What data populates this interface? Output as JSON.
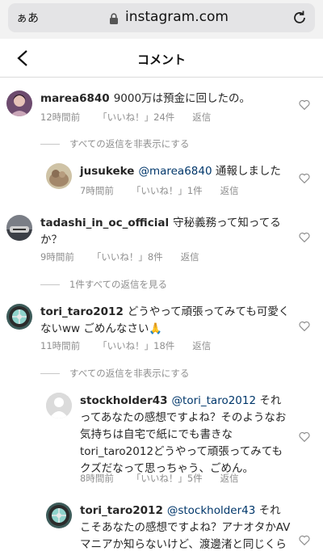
{
  "browser": {
    "text_size_label": "ぁあ",
    "domain": "instagram.com"
  },
  "header": {
    "title": "コメント"
  },
  "comments": [
    {
      "username": "marea6840",
      "text": "9000万は預金に回したの。",
      "time": "12時間前",
      "likes": "「いいね！」24件",
      "reply": "返信",
      "toggle": "すべての返信を非表示にする",
      "replies": [
        {
          "username": "jusukeke",
          "mention": "@marea6840",
          "text": " 通報しました",
          "time": "7時間前",
          "likes": "「いいね！」1件",
          "reply": "返信"
        }
      ]
    },
    {
      "username": "tadashi_in_oc_official",
      "text": "守秘義務って知ってるか？",
      "time": "9時間前",
      "likes": "「いいね！」8件",
      "reply": "返信",
      "toggle": "1件すべての返信を見る"
    },
    {
      "username": "tori_taro2012",
      "text": "どうやって頑張ってみても可愛くないww ごめんなさい🙏",
      "time": "11時間前",
      "likes": "「いいね！」18件",
      "reply": "返信",
      "toggle": "すべての返信を非表示にする",
      "replies": [
        {
          "username": "stockholder43",
          "mention": "@tori_taro2012",
          "text": " それってあなたの感想ですよね？そのようなお気持ちは自宅で紙にでも書きなtori_taro2012どうやって頑張ってみてもクズだなって思っちゃう、ごめん。",
          "time": "8時間前",
          "likes": "「いいね！」5件",
          "reply": "返信"
        },
        {
          "username": "tori_taro2012",
          "mention": "@stockholder43",
          "text": " それこそあなたの感想ですよね？アナオタかAVマニアか知らないけど、渡邊渚と同じくら"
        }
      ]
    }
  ],
  "colors": {
    "text": "#262626",
    "secondary": "#8e8e8e",
    "mention": "#00376b"
  }
}
